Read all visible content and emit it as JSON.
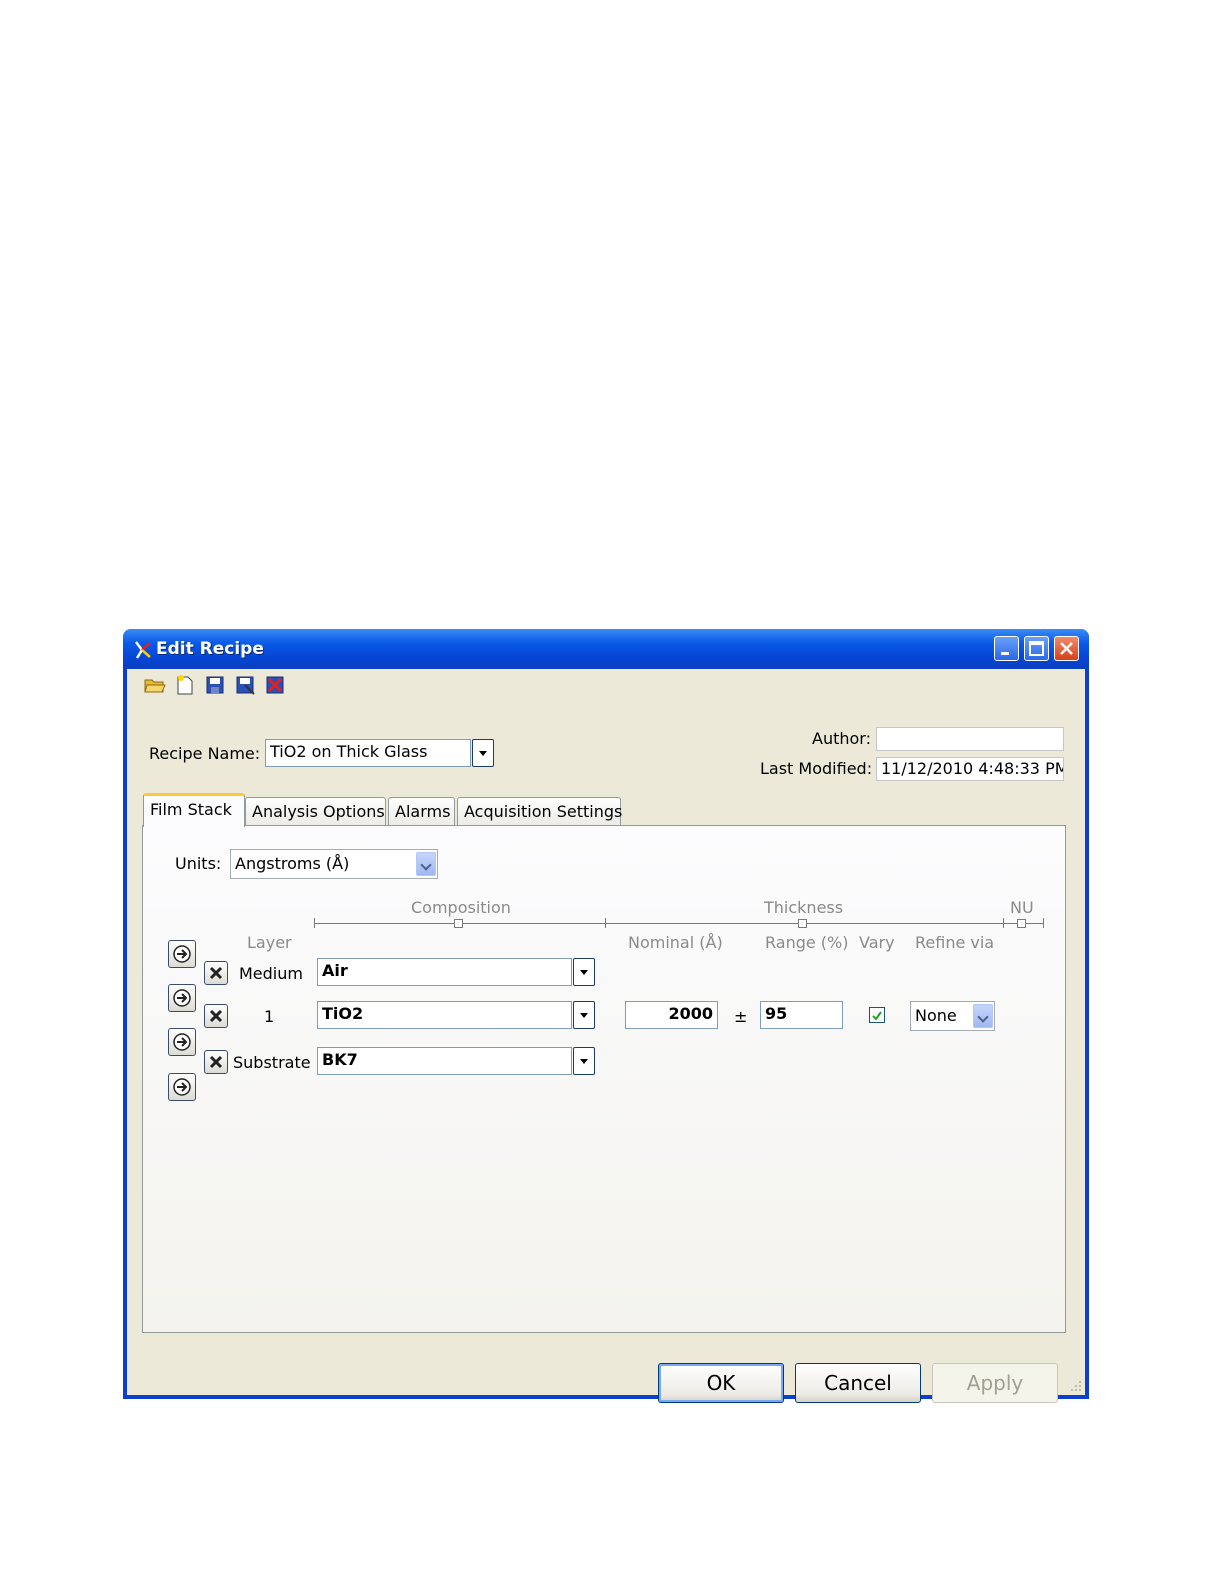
{
  "window": {
    "title": "Edit Recipe",
    "title_bar_color": "#0a5ae8",
    "controls": [
      "minimize-icon",
      "maximize-icon",
      "close-icon"
    ]
  },
  "toolbar": {
    "icons": [
      "open-folder-icon",
      "new-file-icon",
      "save-icon",
      "save-as-icon",
      "delete-icon"
    ]
  },
  "recipe": {
    "name_label": "Recipe Name:",
    "name_value": "TiO2 on Thick Glass",
    "author_label": "Author:",
    "author_value": "",
    "modified_label": "Last Modified:",
    "modified_value": "11/12/2010 4:48:33 PM"
  },
  "tabs": [
    {
      "label": "Film Stack",
      "active": true
    },
    {
      "label": "Analysis Options",
      "active": false
    },
    {
      "label": "Alarms",
      "active": false
    },
    {
      "label": "Acquisition Settings",
      "active": false
    }
  ],
  "film_stack": {
    "units_label": "Units:",
    "units_value": "Angstroms (Å)",
    "section_headers": {
      "composition": "Composition",
      "thickness": "Thickness",
      "nu": "NU"
    },
    "columns": {
      "layer": "Layer",
      "nominal": "Nominal (Å)",
      "range": "Range (%)",
      "vary": "Vary",
      "refine": "Refine via"
    },
    "layers": [
      {
        "name": "Medium",
        "material": "Air"
      },
      {
        "name": "1",
        "material": "TiO2",
        "nominal": "2000",
        "plus_minus": "±",
        "range": "95",
        "vary": true,
        "refine": "None"
      },
      {
        "name": "Substrate",
        "material": "BK7"
      }
    ]
  },
  "buttons": {
    "ok": "OK",
    "cancel": "Cancel",
    "apply": "Apply"
  }
}
